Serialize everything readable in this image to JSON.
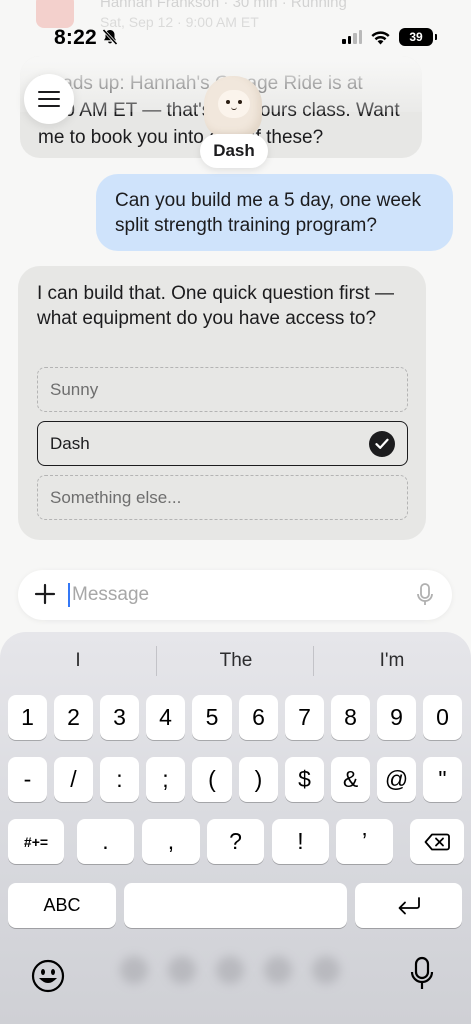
{
  "status_bar": {
    "time": "8:22",
    "battery": "39"
  },
  "background_notification": {
    "title": "Hannah Frankson · 30 min · Running",
    "subtitle": "Sat, Sep 12 · 9:00 AM ET"
  },
  "assistant": {
    "name": "Dash"
  },
  "messages": {
    "previous_bot_text": "Heads up: Hannah's Garage Ride is at 9:00 AM ET — that's a 6-hours class. Want me to book you into any of these?",
    "user_text": "Can you build me a 5 day, one week split strength training program?",
    "bot_text": "I can build that. One quick question first — what equipment do you have access to?",
    "options": [
      {
        "label": "Sunny",
        "selected": false
      },
      {
        "label": "Dash",
        "selected": true
      },
      {
        "label": "Something else...",
        "selected": false
      }
    ]
  },
  "composer": {
    "placeholder": "Message",
    "value": ""
  },
  "keyboard": {
    "suggestions": [
      "I",
      "The",
      "I'm"
    ],
    "row1": [
      "1",
      "2",
      "3",
      "4",
      "5",
      "6",
      "7",
      "8",
      "9",
      "0"
    ],
    "row2": [
      "-",
      "/",
      ":",
      ";",
      "(",
      ")",
      "$",
      "&",
      "@",
      "\""
    ],
    "row3_mode": "#+=",
    "row3": [
      ".",
      ",",
      "?",
      "!",
      "’"
    ],
    "abc": "ABC",
    "space": ""
  },
  "colors": {
    "user_bubble": "#cfe3fb",
    "bot_bubble": "#e7e7e5",
    "caret": "#3478f6"
  },
  "icons": [
    "bell-slash-icon",
    "signal-icon",
    "wifi-icon",
    "battery-icon",
    "menu-icon",
    "plus-icon",
    "microphone-icon",
    "checkmark-icon",
    "delete-icon",
    "return-icon",
    "emoji-icon"
  ]
}
